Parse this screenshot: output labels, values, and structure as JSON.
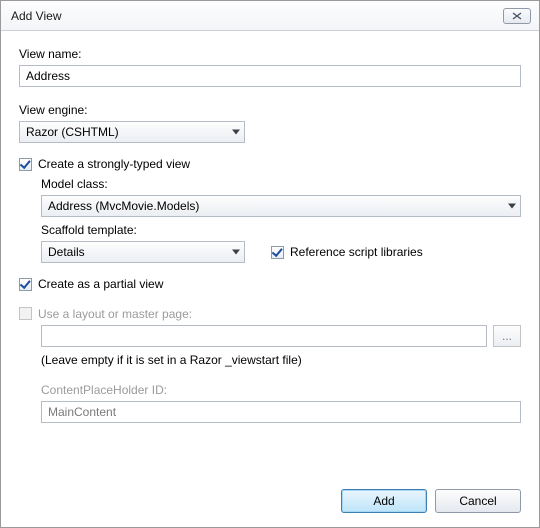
{
  "window": {
    "title": "Add View"
  },
  "viewName": {
    "label": "View name:",
    "value": "Address"
  },
  "viewEngine": {
    "label": "View engine:",
    "value": "Razor (CSHTML)"
  },
  "stronglyTyped": {
    "label": "Create a strongly-typed view",
    "checked": true,
    "modelClass": {
      "label": "Model class:",
      "value": "Address (MvcMovie.Models)"
    },
    "scaffold": {
      "label": "Scaffold template:",
      "value": "Details"
    },
    "referenceScripts": {
      "label": "Reference script libraries",
      "checked": true
    }
  },
  "partial": {
    "label": "Create as a partial view",
    "checked": true
  },
  "layout": {
    "useLayoutLabel": "Use a layout or master page:",
    "checked": false,
    "path": "",
    "hint": "(Leave empty if it is set in a Razor _viewstart file)",
    "placeholderLabel": "ContentPlaceHolder ID:",
    "placeholderValue": "MainContent"
  },
  "buttons": {
    "add": "Add",
    "cancel": "Cancel"
  }
}
